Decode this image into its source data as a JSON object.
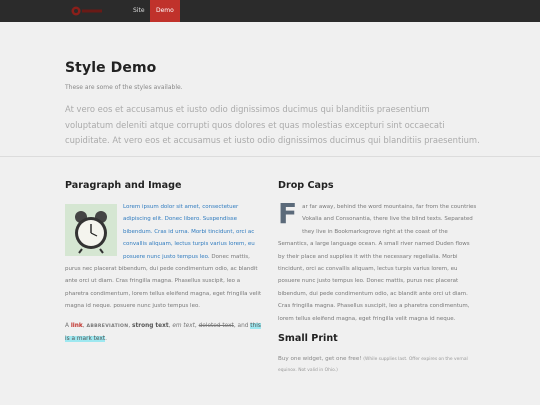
{
  "nav": {
    "items": [
      {
        "label": "Site"
      },
      {
        "label": "Demo"
      }
    ],
    "accent": "#c0322b"
  },
  "header": {
    "title": "Style Demo",
    "subtitle": "These are some of the styles available.",
    "lead": "At vero eos et accusamus et iusto odio dignissimos ducimus qui blanditiis praesentium voluptatum deleniti atque corrupti quos dolores et quas molestias excepturi sint occaecati cupiditate. At vero eos et accusamus et iusto odio dignissimos ducimus qui blanditiis praesentium."
  },
  "paragraph_section": {
    "title": "Paragraph and Image",
    "image_icon": "alarm-clock-icon",
    "text_highlight": "Lorem ipsum dolor sit amet, consectetuer adipiscing elit. Donec libero. Suspendisse bibendum. Cras id urna. Morbi tincidunt, orci ac convallis aliquam, lectus turpis varius lorem, eu posuere nunc justo tempus leo.",
    "text_rest": " Donec mattis, purus nec placerat bibendum, dui pede condimentum odio, ac blandit ante orci ut diam. Cras fringilla magna. Phasellus suscipit, leo a pharetra condimentum, lorem tellus eleifend magna, eget fringilla velit magna id neque. posuere nunc justo tempus leo.",
    "inline": {
      "prefix": "A ",
      "link": "link",
      "sep1": ", ",
      "abbr": "ABBREVIATION",
      "sep2": ", ",
      "strong": "strong text",
      "sep3": ", ",
      "em": "em text",
      "sep4": ", ",
      "deleted": "deleted text",
      "sep5": ", and ",
      "mark": "this is a mark text",
      "suffix": "."
    }
  },
  "dropcaps_section": {
    "title": "Drop Caps",
    "letter": "F",
    "text": "ar far away, behind the word mountains, far from the countries Vokalia and Consonantia, there live the blind texts. Separated they live in Bookmarksgrove right at the coast of the Semantics, a large language ocean. A small river named Duden flows by their place and supplies it with the necessary regelialia. Morbi tincidunt, orci ac convallis aliquam, lectus turpis varius lorem, eu posuere nunc justo tempus leo. Donec mattis, purus nec placerat bibendum, dui pede condimentum odio, ac blandit ante orci ut diam. Cras fringilla magna. Phasellus suscipit, leo a pharetra condimentum, lorem tellus eleifend magna, eget fringilla velit magna id neque."
  },
  "small_print_section": {
    "title": "Small Print",
    "main": "Buy one widget, get one free!",
    "fine": "(While supplies last. Offer expires on the vernal equinox. Not valid in Ohio.)"
  }
}
